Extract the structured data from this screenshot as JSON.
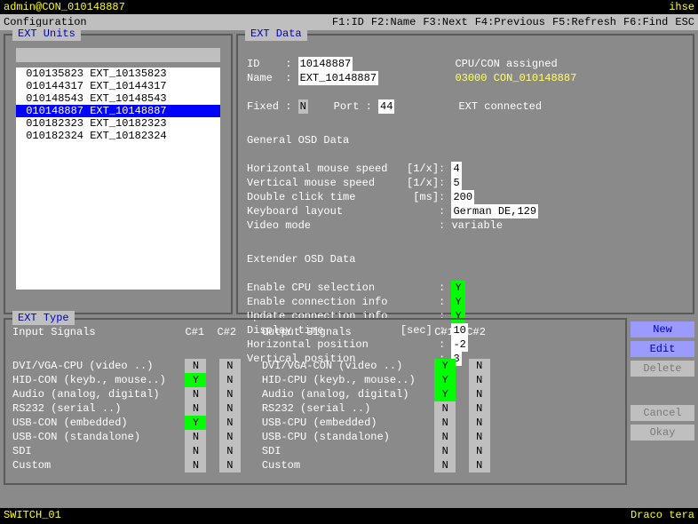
{
  "top": {
    "left": "admin@CON_010148887",
    "right": "ihse"
  },
  "menu": {
    "config": "Configuration",
    "f1": "F1:ID",
    "f2": "F2:Name",
    "f3": "F3:Next",
    "f4": "F4:Previous",
    "f5": "F5:Refresh",
    "f6": "F6:Find",
    "esc": "ESC"
  },
  "panels": {
    "units": "EXT Units",
    "data": "EXT Data",
    "type": "EXT Type"
  },
  "unit_list": [
    "010135823 EXT_10135823",
    "010144317 EXT_10144317",
    "010148543 EXT_10148543",
    "010148887 EXT_10148887",
    "010182323 EXT_10182323",
    "010182324 EXT_10182324"
  ],
  "selected_index": 3,
  "d": {
    "id_label": "ID    : ",
    "id": "10148887",
    "name_label": "Name  : ",
    "name": "EXT_10148887",
    "assigned_label": "CPU/CON assigned",
    "assigned": "03000 CON_010148887",
    "fixed_label": "Fixed : ",
    "fixed": "N",
    "port_label": "Port : ",
    "port": "44",
    "connected": "EXT connected",
    "gosd": "General OSD Data",
    "hms_l": "Horizontal mouse speed   [1/x]: ",
    "hms": "4",
    "vms_l": "Vertical mouse speed     [1/x]: ",
    "vms": "5",
    "dct_l": "Double click time         [ms]: ",
    "dct": "200",
    "kbl_l": "Keyboard layout               : ",
    "kbl": "German DE,129",
    "vm_l": "Video mode                    : ",
    "vm": "variable",
    "eosd": "Extender OSD Data",
    "ecs_l": "Enable CPU selection          : ",
    "ecs": "Y",
    "eci_l": "Enable connection info        : ",
    "eci": "Y",
    "uci_l": "Update connection info        : ",
    "uci": "Y",
    "dt_l": "Display time            [sec] : ",
    "dt": "10",
    "hp_l": "Horizontal position           : ",
    "hp": "-2",
    "vp_l": "Vertical position             : ",
    "vp": "3"
  },
  "sig": {
    "in_label": "Input Signals",
    "out_label": "Output Signals",
    "c1": "C#1",
    "c2": "C#2",
    "in_rows": [
      {
        "n": "DVI/VGA-CPU (video ..)",
        "c1": "N",
        "c2": "N"
      },
      {
        "n": "HID-CON (keyb., mouse..)",
        "c1": "Y",
        "c2": "N"
      },
      {
        "n": "Audio (analog, digital)",
        "c1": "N",
        "c2": "N"
      },
      {
        "n": "RS232 (serial ..)",
        "c1": "N",
        "c2": "N"
      },
      {
        "n": "USB-CON (embedded)",
        "c1": "Y",
        "c2": "N"
      },
      {
        "n": "USB-CON (standalone)",
        "c1": "N",
        "c2": "N"
      },
      {
        "n": "SDI",
        "c1": "N",
        "c2": "N"
      },
      {
        "n": "Custom",
        "c1": "N",
        "c2": "N"
      }
    ],
    "out_rows": [
      {
        "n": "DVI/VGA-CON (video ..)",
        "c1": "Y",
        "c2": "N"
      },
      {
        "n": "HID-CPU (keyb., mouse..)",
        "c1": "Y",
        "c2": "N"
      },
      {
        "n": "Audio (analog, digital)",
        "c1": "Y",
        "c2": "N"
      },
      {
        "n": "RS232 (serial ..)",
        "c1": "N",
        "c2": "N"
      },
      {
        "n": "USB-CPU (embedded)",
        "c1": "N",
        "c2": "N"
      },
      {
        "n": "USB-CPU (standalone)",
        "c1": "N",
        "c2": "N"
      },
      {
        "n": "SDI",
        "c1": "N",
        "c2": "N"
      },
      {
        "n": "Custom",
        "c1": "N",
        "c2": "N"
      }
    ]
  },
  "buttons": {
    "new": "New",
    "edit": "Edit",
    "delete": "Delete",
    "cancel": "Cancel",
    "okay": "Okay"
  },
  "bottom": {
    "left": "SWITCH_01",
    "right": "Draco tera"
  }
}
